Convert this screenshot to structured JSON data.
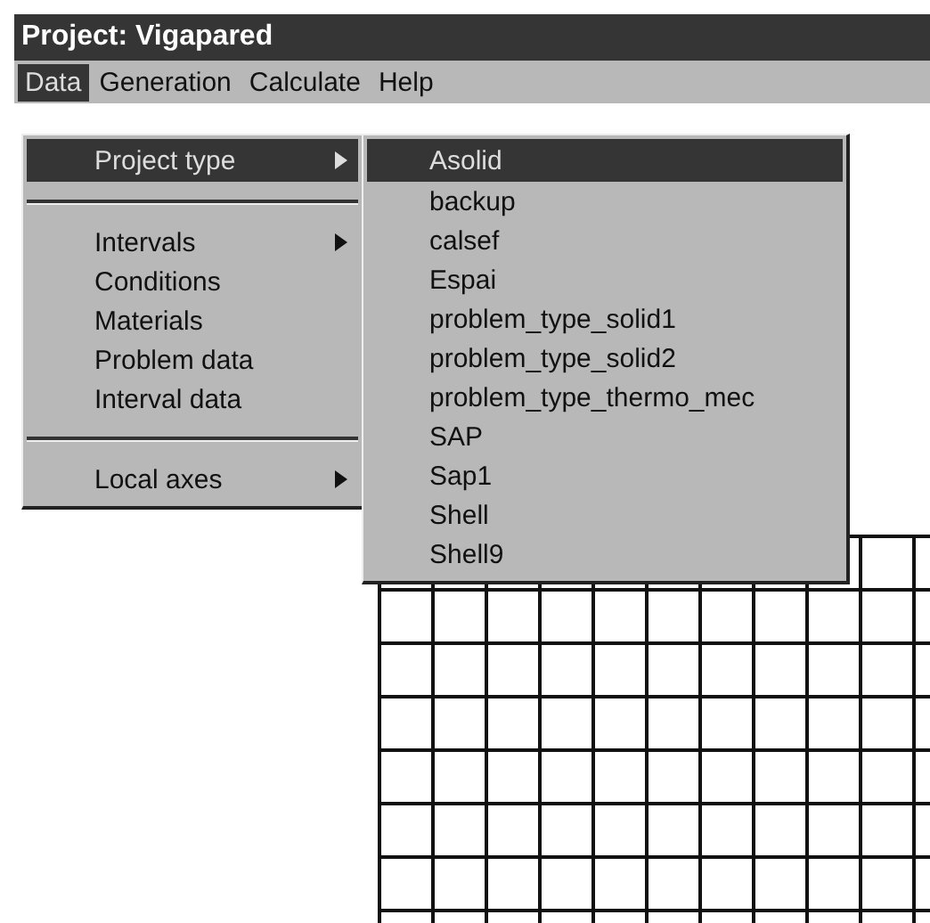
{
  "window": {
    "title": "Project: Vigapared"
  },
  "menubar": [
    {
      "label": "Data",
      "selected": true
    },
    {
      "label": "Generation",
      "selected": false
    },
    {
      "label": "Calculate",
      "selected": false
    },
    {
      "label": "Help",
      "selected": false
    }
  ],
  "data_menu": {
    "items": [
      {
        "kind": "item",
        "label": "Project type",
        "has_submenu": true,
        "selected": true
      },
      {
        "kind": "separator"
      },
      {
        "kind": "item",
        "label": "Intervals",
        "has_submenu": true,
        "selected": false
      },
      {
        "kind": "item",
        "label": "Conditions",
        "has_submenu": false,
        "selected": false
      },
      {
        "kind": "item",
        "label": "Materials",
        "has_submenu": false,
        "selected": false
      },
      {
        "kind": "item",
        "label": "Problem data",
        "has_submenu": false,
        "selected": false
      },
      {
        "kind": "item",
        "label": "Interval data",
        "has_submenu": false,
        "selected": false
      },
      {
        "kind": "separator"
      },
      {
        "kind": "item",
        "label": "Local axes",
        "has_submenu": true,
        "selected": false
      }
    ]
  },
  "project_type_menu": {
    "items": [
      {
        "kind": "item",
        "label": "Asolid",
        "has_submenu": false,
        "selected": true
      },
      {
        "kind": "item",
        "label": "backup",
        "has_submenu": false,
        "selected": false
      },
      {
        "kind": "item",
        "label": "calsef",
        "has_submenu": false,
        "selected": false
      },
      {
        "kind": "item",
        "label": "Espai",
        "has_submenu": false,
        "selected": false
      },
      {
        "kind": "item",
        "label": "problem_type_solid1",
        "has_submenu": false,
        "selected": false
      },
      {
        "kind": "item",
        "label": "problem_type_solid2",
        "has_submenu": false,
        "selected": false
      },
      {
        "kind": "item",
        "label": "problem_type_thermo_mec",
        "has_submenu": false,
        "selected": false
      },
      {
        "kind": "item",
        "label": "SAP",
        "has_submenu": false,
        "selected": false
      },
      {
        "kind": "item",
        "label": "Sap1",
        "has_submenu": false,
        "selected": false
      },
      {
        "kind": "item",
        "label": "Shell",
        "has_submenu": false,
        "selected": false
      },
      {
        "kind": "item",
        "label": "Shell9",
        "has_submenu": false,
        "selected": false
      }
    ]
  }
}
